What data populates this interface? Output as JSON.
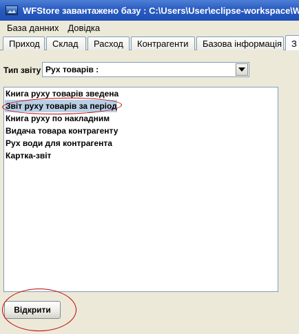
{
  "window": {
    "title": "WFStore завантажено базу : C:\\Users\\User\\eclipse-workspace\\WFStore"
  },
  "menubar": {
    "items": [
      "База данних",
      "Довідка"
    ]
  },
  "tabs": {
    "items": [
      "Приход",
      "Склад",
      "Расход",
      "Контрагенти",
      "Базова інформація",
      "З"
    ],
    "active_index": 5
  },
  "report": {
    "type_label": "Тип звіту :",
    "type_value": "Рух товарів :"
  },
  "report_list": {
    "items": [
      "Книга руху товарів зведена",
      "Звіт руху товарів за період",
      "Книга руху по накладним",
      "Видача товара контрагенту",
      "Рух води для контрагента",
      "Картка-звіт"
    ],
    "selected_index": 1
  },
  "actions": {
    "open_label": "Відкрити"
  },
  "colors": {
    "title_bar": "#2a5cc2",
    "selection": "#b8cfe5",
    "annotation": "#c00000"
  }
}
